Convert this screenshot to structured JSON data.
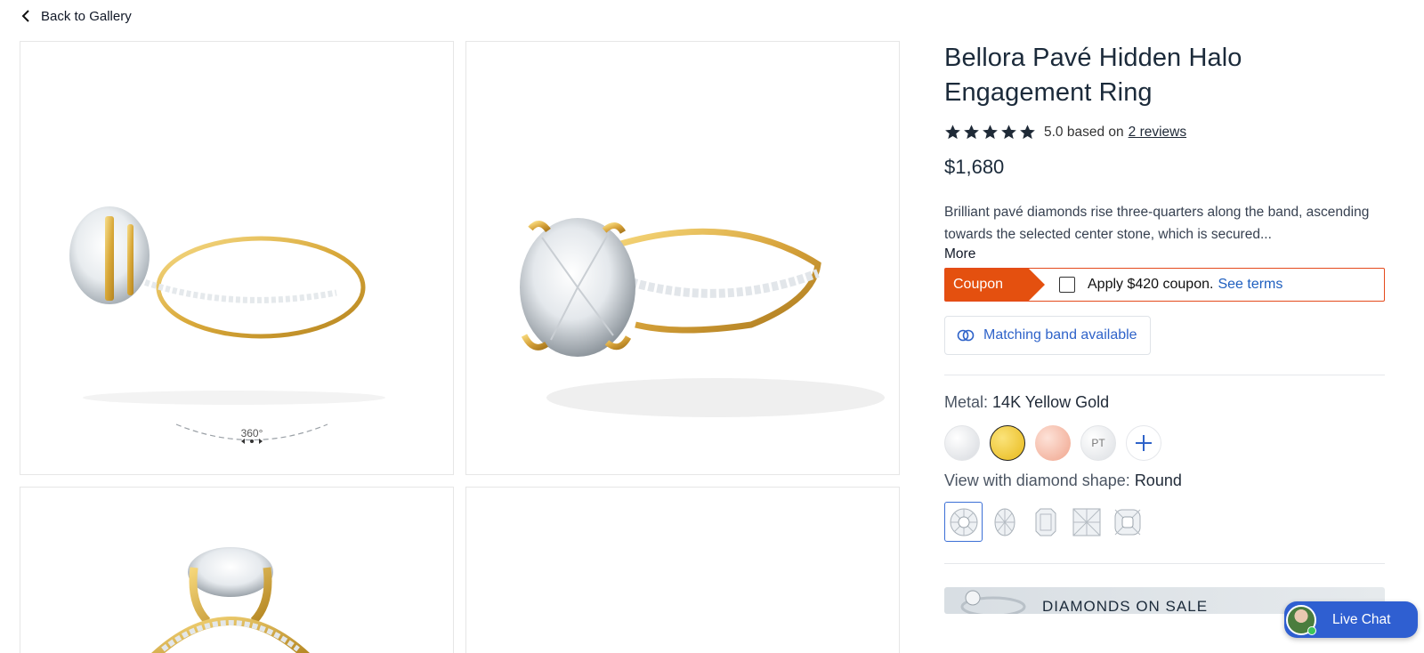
{
  "nav": {
    "back_label": "Back to Gallery"
  },
  "gallery": {
    "spin_label": "360°"
  },
  "product": {
    "title": "Bellora Pavé Hidden Halo Engagement Ring",
    "rating_value": 5.0,
    "rating_text": "5.0 based on",
    "reviews_link": "2 reviews",
    "price": "$1,680",
    "description": "Brilliant pavé diamonds rise three-quarters along the band, ascending towards the selected center stone, which is secured...",
    "more_label": "More"
  },
  "coupon": {
    "tag": "Coupon",
    "text": "Apply $420 coupon.",
    "terms": "See terms",
    "checked": false
  },
  "matching_band": {
    "label": "Matching band available"
  },
  "metal": {
    "label": "Metal:",
    "selected": "14K Yellow Gold",
    "options": [
      {
        "name": "white-gold",
        "text": ""
      },
      {
        "name": "yellow-gold",
        "text": ""
      },
      {
        "name": "rose-gold",
        "text": ""
      },
      {
        "name": "platinum",
        "text": "PT"
      },
      {
        "name": "more",
        "text": ""
      }
    ],
    "colors": {
      "yellow": "#f0c53a",
      "rose": "#f3b4a0",
      "white": "#e4e6ea"
    }
  },
  "shape": {
    "label": "View with diamond shape:",
    "selected": "Round",
    "options": [
      "round",
      "oval",
      "emerald",
      "princess",
      "cushion"
    ]
  },
  "banner": {
    "text": "DIAMONDS ON SALE"
  },
  "chat": {
    "label": "Live Chat"
  },
  "colors": {
    "accent": "#2f63c9",
    "coupon": "#e4500f",
    "chat": "#2f5fd1"
  }
}
